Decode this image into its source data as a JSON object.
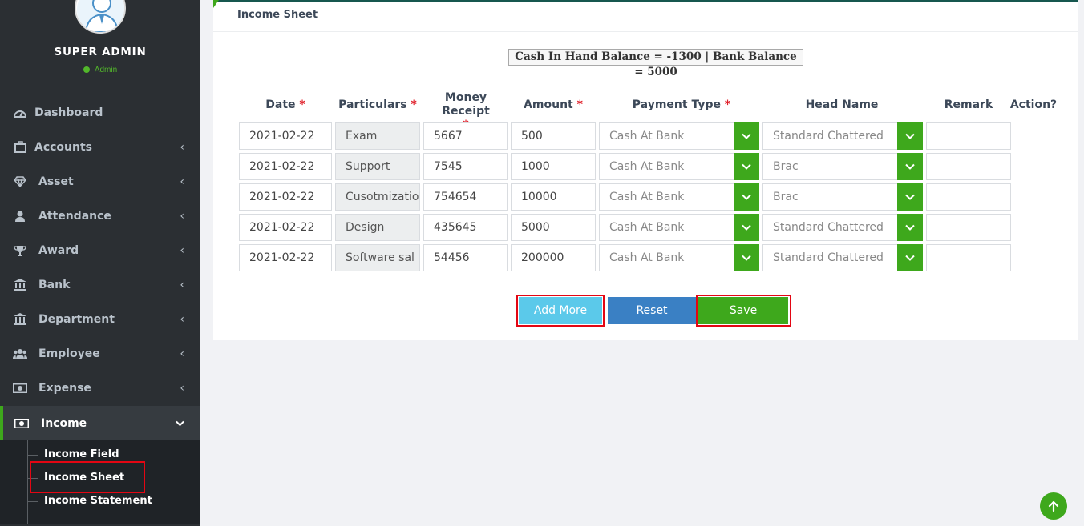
{
  "profile": {
    "name": "SUPER ADMIN",
    "role": "Admin"
  },
  "sidebar": {
    "items": [
      {
        "label": "Dashboard",
        "icon": "dashboard-icon"
      },
      {
        "label": "Accounts",
        "icon": "briefcase-icon"
      },
      {
        "label": "Asset",
        "icon": "diamond-icon"
      },
      {
        "label": "Attendance",
        "icon": "user-icon"
      },
      {
        "label": "Award",
        "icon": "trophy-icon"
      },
      {
        "label": "Bank",
        "icon": "bank-icon"
      },
      {
        "label": "Department",
        "icon": "bank-icon"
      },
      {
        "label": "Employee",
        "icon": "users-icon"
      },
      {
        "label": "Expense",
        "icon": "money-icon"
      },
      {
        "label": "Income",
        "icon": "money-icon"
      }
    ],
    "income_submenu": [
      "Income Field",
      "Income Sheet",
      "Income Statement"
    ]
  },
  "panel": {
    "title": "Income Sheet",
    "balance": "Cash In Hand Balance = -1300 | Bank Balance = 5000"
  },
  "table": {
    "headers": {
      "date": "Date",
      "particulars": "Particulars",
      "money_receipt": "Money Receipt",
      "amount": "Amount",
      "payment_type": "Payment Type",
      "head_name": "Head Name",
      "remark": "Remark",
      "action": "Action?"
    },
    "required_mark": "*",
    "rows": [
      {
        "date": "2021-02-22",
        "particulars": "Exam",
        "receipt": "5667",
        "amount": "500",
        "payment_type": "Cash At Bank",
        "head_name": "Standard Chattered",
        "remark": ""
      },
      {
        "date": "2021-02-22",
        "particulars": "Support",
        "receipt": "7545",
        "amount": "1000",
        "payment_type": "Cash At Bank",
        "head_name": "Brac",
        "remark": ""
      },
      {
        "date": "2021-02-22",
        "particulars": "Cusotmization",
        "receipt": "754654",
        "amount": "10000",
        "payment_type": "Cash At Bank",
        "head_name": "Brac",
        "remark": ""
      },
      {
        "date": "2021-02-22",
        "particulars": "Design",
        "receipt": "435645",
        "amount": "5000",
        "payment_type": "Cash At Bank",
        "head_name": "Standard Chattered",
        "remark": ""
      },
      {
        "date": "2021-02-22",
        "particulars": "Software sal",
        "receipt": "54456",
        "amount": "200000",
        "payment_type": "Cash At Bank",
        "head_name": "Standard Chattered",
        "remark": ""
      }
    ]
  },
  "buttons": {
    "add_more": "Add More",
    "reset": "Reset",
    "save": "Save"
  },
  "colors": {
    "sidebar_bg": "#2b2f33",
    "accent_green": "#3ea81c",
    "add_more": "#5bc9ea",
    "reset": "#3a80c4",
    "highlight_red": "#e30613"
  }
}
